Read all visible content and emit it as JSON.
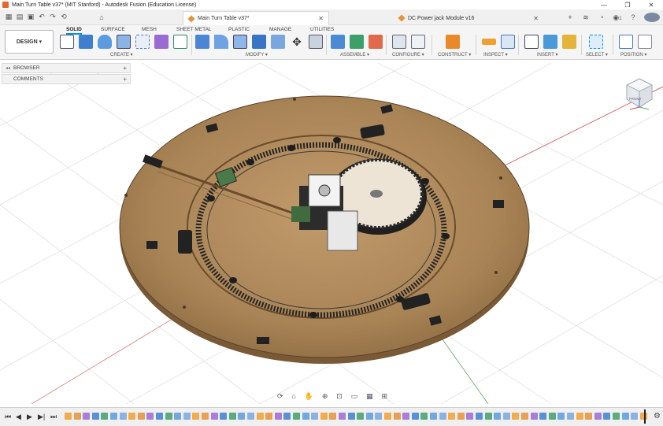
{
  "window": {
    "title": "Main Turn Table v37* (MIT Stanford) - Autodesk Fusion (Education License)",
    "controls": [
      "—",
      "❐",
      "✕"
    ]
  },
  "tabs": [
    {
      "label": "Main Turn Table v37*",
      "active": true
    },
    {
      "label": "DC Power jack Module v16",
      "active": false
    }
  ],
  "tabbar_right": {
    "notifications": "1"
  },
  "ribbon": {
    "workspace": "DESIGN",
    "tabs": [
      "SOLID",
      "SURFACE",
      "MESH",
      "SHEET METAL",
      "PLASTIC",
      "MANAGE",
      "UTILITIES"
    ],
    "active_tab": "SOLID",
    "groups": [
      "CREATE",
      "MODIFY",
      "ASSEMBLE",
      "CONFIGURE",
      "CONSTRUCT",
      "INSPECT",
      "INSERT",
      "SELECT",
      "POSITION"
    ]
  },
  "browser": {
    "rows": [
      {
        "label": "BROWSER"
      },
      {
        "label": "COMMENTS"
      }
    ]
  },
  "viewcube": {
    "face": "FRONT"
  },
  "colors": {
    "accent": "#0696d7",
    "wood": "#b08a5c",
    "gear": "#2a2a2a",
    "grid": "#c8ccd2",
    "axis_red": "#d04a4a",
    "axis_green": "#5aa85a"
  }
}
